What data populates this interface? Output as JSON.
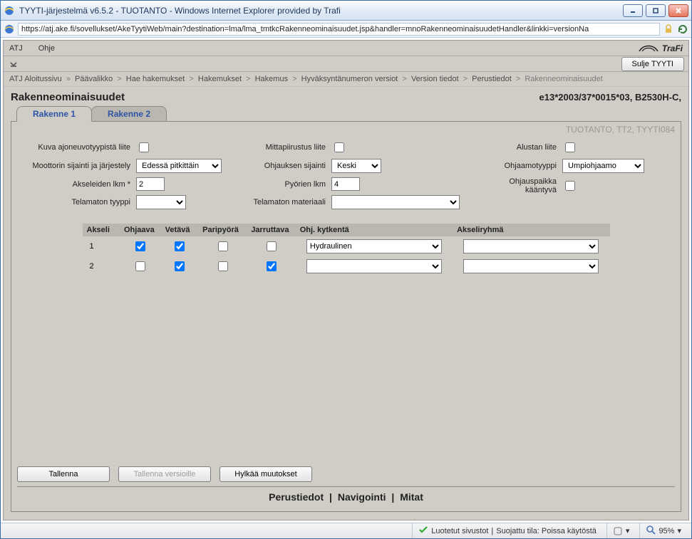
{
  "window": {
    "title": "TYYTI-järjestelmä v6.5.2 - TUOTANTO - Windows Internet Explorer provided by Trafi",
    "url": "https://atj.ake.fi/sovellukset/AkeTyytiWeb/main?destination=lma/lma_tmtkcRakenneominaisuudet.jsp&handler=mnoRakenneominaisuudetHandler&linkki=versionNa"
  },
  "menu": {
    "atj": "ATJ",
    "ohje": "Ohje",
    "brand": "TraFi",
    "close_btn": "Sulje TYYTI"
  },
  "breadcrumb": {
    "items": [
      "ATJ Aloitussivu",
      "Päävalikko",
      "Hae hakemukset",
      "Hakemukset",
      "Hakemus",
      "Hyväksyntänumeron versiot",
      "Version tiedot",
      "Perustiedot",
      "Rakenneominaisuudet"
    ],
    "first_sep": "»",
    "sep": ">"
  },
  "heading": {
    "title": "Rakenneominaisuudet",
    "code": "e13*2003/37*0015*03, B2530H-C,"
  },
  "tabs": {
    "t1": "Rakenne 1",
    "t2": "Rakenne 2"
  },
  "context_stamp": "TUOTANTO, TT2, TYYTI084",
  "form": {
    "kuva_liite_label": "Kuva ajoneuvotyypistä liite",
    "moottori_label": "Moottorin sijainti ja järjestely",
    "moottori_value": "Edessä pitkittäin",
    "akselit_label": "Akseleiden lkm *",
    "akselit_value": "2",
    "telamaton_tyyppi_label": "Telamaton tyyppi",
    "telamaton_tyyppi_value": "",
    "mittapiirustus_label": "Mittapiirustus liite",
    "ohjaus_sij_label": "Ohjauksen sijainti",
    "ohjaus_sij_value": "Keski",
    "pyorien_label": "Pyörien lkm",
    "pyorien_value": "4",
    "telamaton_mat_label": "Telamaton materiaali",
    "telamaton_mat_value": "",
    "alustan_liite_label": "Alustan liite",
    "ohjaamotyyppi_label": "Ohjaamotyyppi",
    "ohjaamotyyppi_value": "Umpiohjaamo",
    "ohjauspaikka_label": "Ohjauspaikka kääntyvä"
  },
  "axle_table": {
    "headers": {
      "akseli": "Akseli",
      "ohjaava": "Ohjaava",
      "vetava": "Vetävä",
      "paripyora": "Paripyörä",
      "jarruttava": "Jarruttava",
      "ohj_kytkenta": "Ohj. kytkentä",
      "akseliryhma": "Akseliryhmä"
    },
    "rows": [
      {
        "akseli": "1",
        "ohjaava": true,
        "vetava": true,
        "paripyora": false,
        "jarruttava": false,
        "ohj_kytkenta": "Hydraulinen",
        "akseliryhma": ""
      },
      {
        "akseli": "2",
        "ohjaava": false,
        "vetava": true,
        "paripyora": false,
        "jarruttava": true,
        "ohj_kytkenta": "",
        "akseliryhma": ""
      }
    ]
  },
  "buttons": {
    "save": "Tallenna",
    "save_versions": "Tallenna versioille",
    "reject": "Hylkää muutokset"
  },
  "footer_links": {
    "perustiedot": "Perustiedot",
    "navigointi": "Navigointi",
    "mitat": "Mitat"
  },
  "status": {
    "trusted": "Luotetut sivustot",
    "protected": "Suojattu tila: Poissa käytöstä",
    "zoom": "95%"
  }
}
